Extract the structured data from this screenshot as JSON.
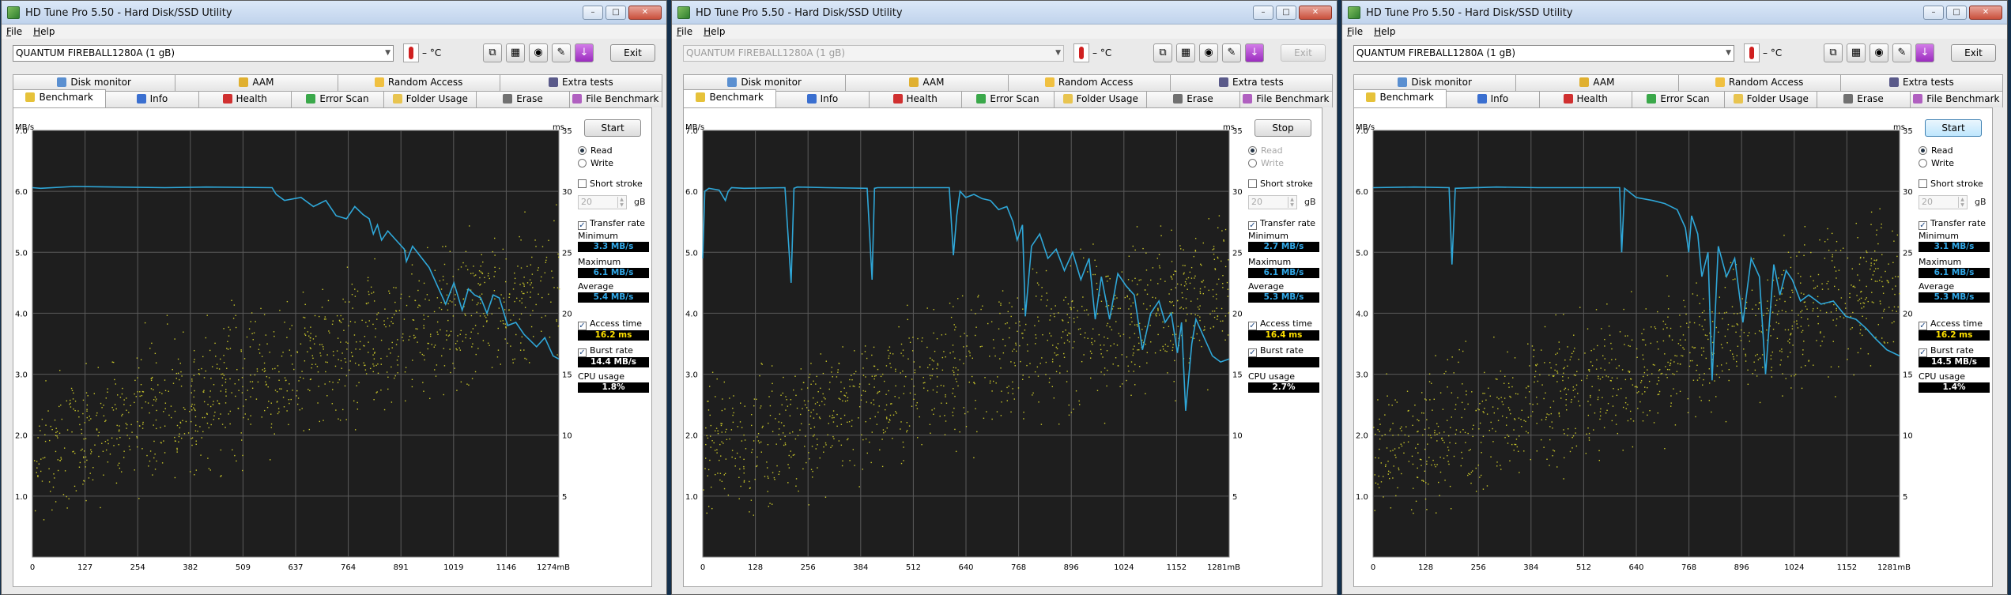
{
  "windows": [
    {
      "title": "HD Tune Pro 5.50 - Hard Disk/SSD Utility",
      "menu": [
        "File",
        "Help"
      ],
      "drive": "QUANTUM FIREBALL1280A (1 gB)",
      "drive_disabled": false,
      "temperature": "– °C",
      "exit_label": "Exit",
      "exit_disabled": false,
      "tabs_row1": [
        "Disk monitor",
        "AAM",
        "Random Access",
        "Extra tests"
      ],
      "tabs_row2": [
        "Benchmark",
        "Info",
        "Health",
        "Error Scan",
        "Folder Usage",
        "Erase",
        "File Benchmark"
      ],
      "start_label": "Start",
      "start_highlight": false,
      "mode_read": "Read",
      "mode_write": "Write",
      "mode_disabled": false,
      "short_stroke_label": "Short stroke",
      "short_stroke_value": "20",
      "short_stroke_unit": "gB",
      "transfer_rate_label": "Transfer rate",
      "minimum_label": "Minimum",
      "minimum": "3.3 MB/s",
      "maximum_label": "Maximum",
      "maximum": "6.1 MB/s",
      "average_label": "Average",
      "average": "5.4 MB/s",
      "access_time_label": "Access time",
      "access_time": "16.2 ms",
      "burst_rate_label": "Burst rate",
      "burst_rate": "14.4 MB/s",
      "cpu_usage_label": "CPU usage",
      "cpu_usage": "1.8%"
    },
    {
      "title": "HD Tune Pro 5.50 - Hard Disk/SSD Utility",
      "menu": [
        "File",
        "Help"
      ],
      "drive": "QUANTUM FIREBALL1280A (1 gB)",
      "drive_disabled": true,
      "temperature": "– °C",
      "exit_label": "Exit",
      "exit_disabled": true,
      "tabs_row1": [
        "Disk monitor",
        "AAM",
        "Random Access",
        "Extra tests"
      ],
      "tabs_row2": [
        "Benchmark",
        "Info",
        "Health",
        "Error Scan",
        "Folder Usage",
        "Erase",
        "File Benchmark"
      ],
      "start_label": "Stop",
      "start_highlight": false,
      "mode_read": "Read",
      "mode_write": "Write",
      "mode_disabled": true,
      "short_stroke_label": "Short stroke",
      "short_stroke_value": "20",
      "short_stroke_unit": "gB",
      "transfer_rate_label": "Transfer rate",
      "minimum_label": "Minimum",
      "minimum": "2.7 MB/s",
      "maximum_label": "Maximum",
      "maximum": "6.1 MB/s",
      "average_label": "Average",
      "average": "5.3 MB/s",
      "access_time_label": "Access time",
      "access_time": "16.4 ms",
      "burst_rate_label": "Burst rate",
      "burst_rate": "",
      "cpu_usage_label": "CPU usage",
      "cpu_usage": "2.7%"
    },
    {
      "title": "HD Tune Pro 5.50 - Hard Disk/SSD Utility",
      "menu": [
        "File",
        "Help"
      ],
      "drive": "QUANTUM FIREBALL1280A (1 gB)",
      "drive_disabled": false,
      "temperature": "– °C",
      "exit_label": "Exit",
      "exit_disabled": false,
      "tabs_row1": [
        "Disk monitor",
        "AAM",
        "Random Access",
        "Extra tests"
      ],
      "tabs_row2": [
        "Benchmark",
        "Info",
        "Health",
        "Error Scan",
        "Folder Usage",
        "Erase",
        "File Benchmark"
      ],
      "start_label": "Start",
      "start_highlight": true,
      "mode_read": "Read",
      "mode_write": "Write",
      "mode_disabled": false,
      "short_stroke_label": "Short stroke",
      "short_stroke_value": "20",
      "short_stroke_unit": "gB",
      "transfer_rate_label": "Transfer rate",
      "minimum_label": "Minimum",
      "minimum": "3.1 MB/s",
      "maximum_label": "Maximum",
      "maximum": "6.1 MB/s",
      "average_label": "Average",
      "average": "5.3 MB/s",
      "access_time_label": "Access time",
      "access_time": "16.2 ms",
      "burst_rate_label": "Burst rate",
      "burst_rate": "14.5 MB/s",
      "cpu_usage_label": "CPU usage",
      "cpu_usage": "1.4%"
    }
  ],
  "colors": {
    "chart_bg": "#1e1e1e",
    "grid": "#5a5a5a",
    "transfer_line": "#2fa7d8",
    "access_dots": "#c9c62a",
    "value_blue": "#31a8e8",
    "value_yellow": "#ffe100"
  },
  "chart_data": [
    {
      "type": "line",
      "ylabel": "MB/s",
      "y2label": "ms",
      "ylim": [
        0,
        7
      ],
      "y2lim": [
        0,
        35
      ],
      "yticks": [
        "7.0",
        "6.0",
        "5.0",
        "4.0",
        "3.0",
        "2.0",
        "1.0"
      ],
      "y2ticks": [
        "35",
        "30",
        "25",
        "20",
        "15",
        "10",
        "5"
      ],
      "xlim": [
        0,
        1274
      ],
      "xticks": [
        "0",
        "127",
        "254",
        "382",
        "509",
        "637",
        "764",
        "891",
        "1019",
        "1146",
        "1274mB"
      ],
      "series": [
        {
          "x": [
            0,
            20,
            100,
            200,
            320,
            420,
            580,
            590,
            610,
            650,
            680,
            710,
            735,
            760,
            780,
            800,
            815,
            825,
            835,
            845,
            860,
            880,
            900,
            905,
            920,
            960,
            980,
            1000,
            1020,
            1040,
            1055,
            1070,
            1085,
            1100,
            1115,
            1130,
            1150,
            1170,
            1190,
            1205,
            1220,
            1240,
            1260,
            1274
          ],
          "y": [
            6.06,
            6.05,
            6.08,
            6.07,
            6.06,
            6.07,
            6.06,
            5.95,
            5.85,
            5.9,
            5.75,
            5.85,
            5.6,
            5.55,
            5.75,
            5.62,
            5.55,
            5.3,
            5.45,
            5.2,
            5.35,
            5.2,
            5.05,
            4.85,
            5.1,
            4.75,
            4.45,
            4.15,
            4.5,
            4.05,
            4.4,
            4.3,
            4.25,
            4.0,
            4.3,
            4.25,
            3.8,
            3.85,
            3.65,
            3.55,
            3.45,
            3.6,
            3.3,
            3.25
          ]
        }
      ]
    },
    {
      "type": "line",
      "ylabel": "MB/s",
      "y2label": "ms",
      "ylim": [
        0,
        7
      ],
      "y2lim": [
        0,
        35
      ],
      "yticks": [
        "7.0",
        "6.0",
        "5.0",
        "4.0",
        "3.0",
        "2.0",
        "1.0"
      ],
      "y2ticks": [
        "35",
        "30",
        "25",
        "20",
        "15",
        "10",
        "5"
      ],
      "xlim": [
        0,
        1281
      ],
      "xticks": [
        "0",
        "128",
        "256",
        "384",
        "512",
        "640",
        "768",
        "896",
        "1024",
        "1152",
        "1281mB"
      ],
      "series": [
        {
          "x": [
            0,
            5,
            15,
            40,
            55,
            62,
            70,
            100,
            200,
            215,
            222,
            230,
            300,
            400,
            412,
            418,
            425,
            500,
            600,
            610,
            618,
            626,
            640,
            660,
            680,
            700,
            720,
            740,
            755,
            765,
            778,
            785,
            800,
            820,
            840,
            860,
            880,
            900,
            920,
            940,
            955,
            970,
            990,
            1010,
            1030,
            1050,
            1070,
            1090,
            1110,
            1125,
            1140,
            1155,
            1165,
            1175,
            1190,
            1200,
            1220,
            1240,
            1260,
            1281
          ],
          "y": [
            4.9,
            6.0,
            6.05,
            6.02,
            5.85,
            6.0,
            6.06,
            6.05,
            6.06,
            4.5,
            6.05,
            6.07,
            6.06,
            6.05,
            4.55,
            6.05,
            6.06,
            6.06,
            6.06,
            4.95,
            5.6,
            6.0,
            5.9,
            5.95,
            5.88,
            5.85,
            5.7,
            5.75,
            5.5,
            5.2,
            5.45,
            3.95,
            5.1,
            5.3,
            4.9,
            5.05,
            4.7,
            5.0,
            4.55,
            4.9,
            3.9,
            4.6,
            3.9,
            4.65,
            4.45,
            4.3,
            3.4,
            4.0,
            4.2,
            3.85,
            4.0,
            3.35,
            3.85,
            2.4,
            3.5,
            3.9,
            3.6,
            3.3,
            3.2,
            3.25
          ]
        }
      ]
    },
    {
      "type": "line",
      "ylabel": "MB/s",
      "y2label": "ms",
      "ylim": [
        0,
        7
      ],
      "y2lim": [
        0,
        35
      ],
      "yticks": [
        "7.0",
        "6.0",
        "5.0",
        "4.0",
        "3.0",
        "2.0",
        "1.0"
      ],
      "y2ticks": [
        "35",
        "30",
        "25",
        "20",
        "15",
        "10",
        "5"
      ],
      "xlim": [
        0,
        1281
      ],
      "xticks": [
        "0",
        "128",
        "256",
        "384",
        "512",
        "640",
        "768",
        "896",
        "1024",
        "1152",
        "1281mB"
      ],
      "series": [
        {
          "x": [
            0,
            100,
            185,
            192,
            200,
            300,
            400,
            600,
            605,
            612,
            640,
            680,
            710,
            740,
            760,
            768,
            775,
            790,
            800,
            815,
            825,
            840,
            860,
            880,
            900,
            920,
            940,
            955,
            975,
            990,
            1005,
            1020,
            1040,
            1060,
            1090,
            1120,
            1150,
            1175,
            1200,
            1220,
            1250,
            1281
          ],
          "y": [
            6.06,
            6.07,
            6.06,
            4.8,
            6.05,
            6.07,
            6.06,
            6.06,
            5.0,
            6.05,
            5.9,
            5.85,
            5.8,
            5.7,
            5.4,
            5.0,
            5.6,
            5.3,
            4.6,
            5.0,
            2.9,
            5.1,
            4.6,
            4.9,
            3.85,
            4.9,
            4.6,
            3.0,
            4.8,
            4.3,
            4.7,
            4.55,
            4.2,
            4.3,
            4.15,
            4.2,
            3.95,
            3.9,
            3.75,
            3.6,
            3.4,
            3.3
          ]
        }
      ]
    }
  ]
}
